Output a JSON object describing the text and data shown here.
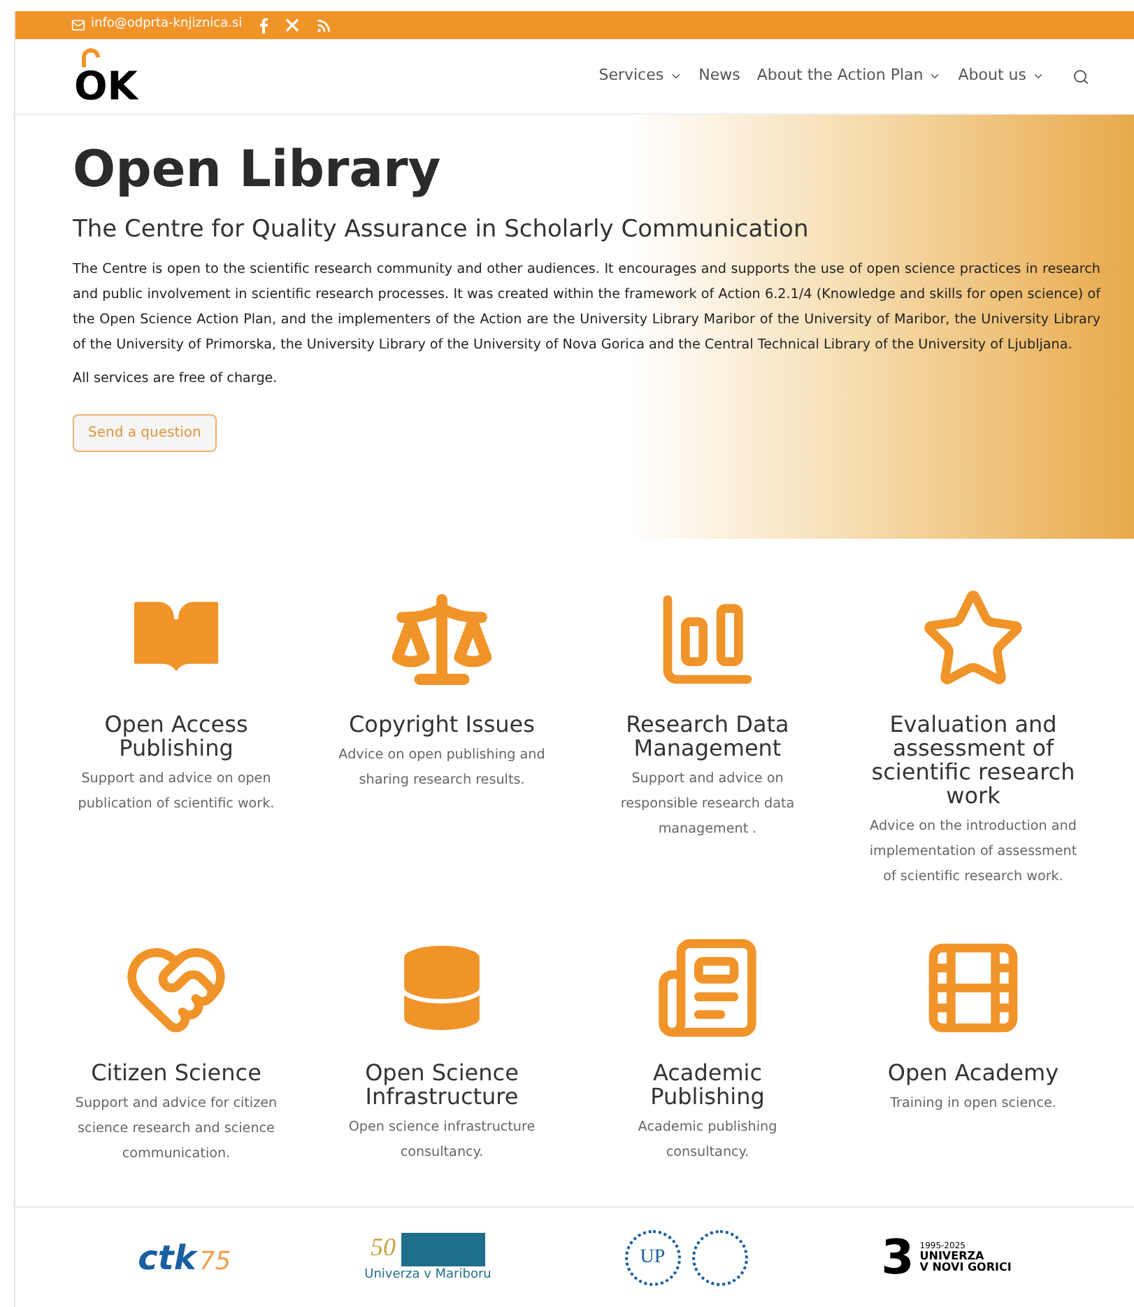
{
  "top_bar": {
    "email": "info@odprta-knjiznica.si"
  },
  "header": {
    "logo": "OK",
    "nav": [
      {
        "label": "Services",
        "dropdown": true
      },
      {
        "label": "News",
        "dropdown": false
      },
      {
        "label": "About the Action Plan",
        "dropdown": true
      },
      {
        "label": "About us",
        "dropdown": true
      }
    ]
  },
  "hero": {
    "title": "Open Library",
    "subtitle": "The Centre for Quality Assurance in Scholarly Communication",
    "paragraphs": [
      "The Centre is open to the scientific research community and other audiences. It encourages and supports the use of open science practices in research and public involvement in scientific research processes. It was created within the framework of Action 6.2.1/4 (Knowledge and skills for open science) of the Open Science Action Plan, and the implementers of the Action are the University Library Maribor of the University of Maribor, the University Library of the University of Primorska, the University Library of the University of Nova Gorica and the Central Technical Library of the University of Ljubljana.",
      "All services are free of charge."
    ],
    "button": "Send a question"
  },
  "services": [
    {
      "kind": "book",
      "title": "Open Access Publishing",
      "text": "Support and advice on open publication of scientific work."
    },
    {
      "kind": "scale",
      "title": "Copyright Issues",
      "text": "Advice on open publishing and sharing research results."
    },
    {
      "kind": "chart",
      "title": "Research Data Management",
      "text": "Support and advice on responsible research data management ."
    },
    {
      "kind": "star",
      "title": "Evaluation and assessment of scientific research work",
      "text": "Advice on the introduction and implementation of assessment of scientific research work."
    },
    {
      "kind": "hands",
      "title": "Citizen Science",
      "text": "Support and advice for citizen science research and science communication."
    },
    {
      "kind": "database",
      "title": "Open Science Infrastructure",
      "text": "Open science infrastructure consultancy."
    },
    {
      "kind": "newspaper",
      "title": "Academic Publishing",
      "text": "Academic publishing consultancy."
    },
    {
      "kind": "film",
      "title": "Open Academy",
      "text": "Training in open science."
    }
  ],
  "partners": [
    {
      "kind": "ctk",
      "texts": [
        "ctk",
        "75"
      ]
    },
    {
      "kind": "um",
      "texts": [
        "50",
        "Univerza v Mariboru"
      ]
    },
    {
      "kind": "up",
      "texts": [
        "UP"
      ]
    },
    {
      "kind": "ung",
      "texts": [
        "3",
        "1995-2025",
        "UNIVERZA",
        "V NOVI GORICI"
      ]
    }
  ]
}
